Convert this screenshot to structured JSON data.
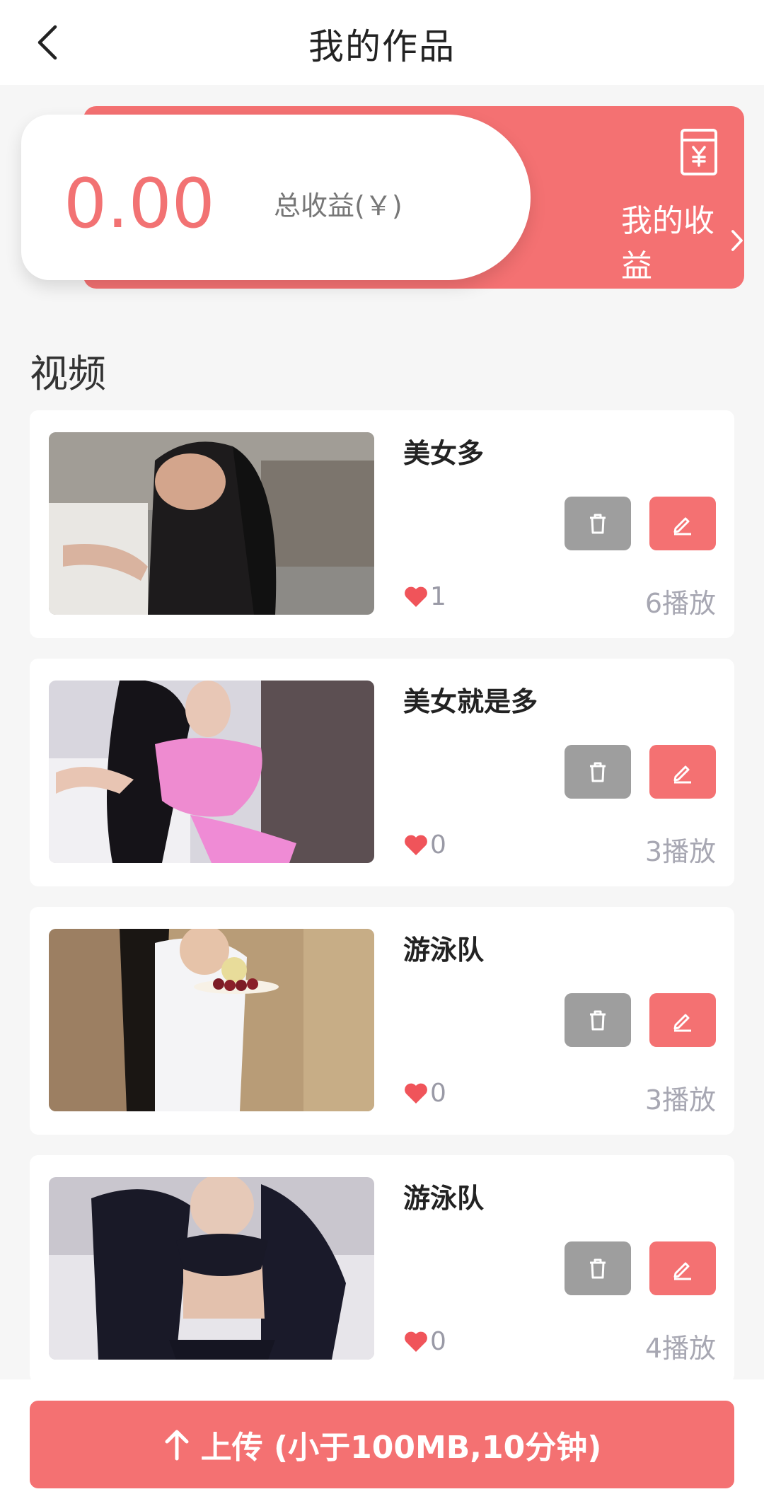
{
  "header": {
    "title": "我的作品",
    "back_icon": "chevron-left-icon"
  },
  "earnings": {
    "amount": "0.00",
    "label": "总收益(￥)",
    "link_label": "我的收益",
    "icon": "yen-envelope-icon",
    "accent": "#f47172"
  },
  "section": {
    "title": "视频"
  },
  "videos": [
    {
      "title": "美女多",
      "likes": "1",
      "plays": "6播放"
    },
    {
      "title": "美女就是多",
      "likes": "0",
      "plays": "3播放"
    },
    {
      "title": "游泳队",
      "likes": "0",
      "plays": "3播放"
    },
    {
      "title": "游泳队",
      "likes": "0",
      "plays": "4播放"
    }
  ],
  "upload": {
    "label": "上传 (小于100MB,10分钟)",
    "icon": "arrow-up-icon"
  },
  "colors": {
    "accent": "#f47172",
    "delete_button": "#9e9e9e",
    "muted_text": "#a7a7b2"
  }
}
